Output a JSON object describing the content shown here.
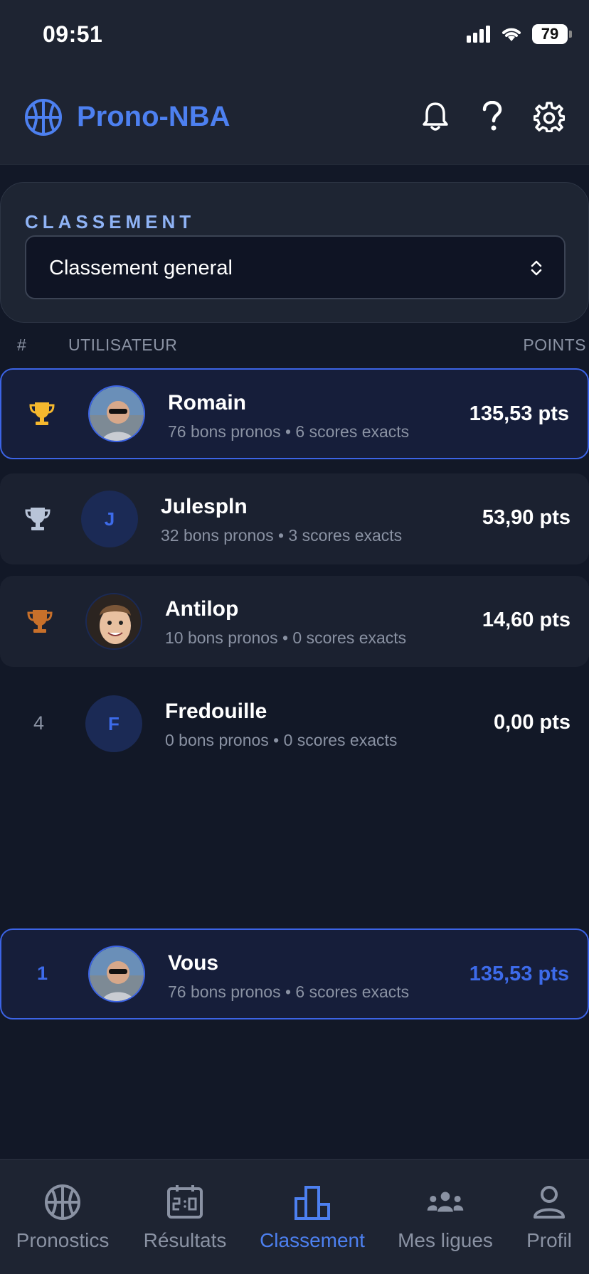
{
  "status": {
    "time": "09:51",
    "battery": "79"
  },
  "header": {
    "title": "Prono-NBA",
    "icons": [
      "basketball-icon",
      "bell-icon",
      "help-icon",
      "gear-icon"
    ]
  },
  "filter": {
    "label": "CLASSEMENT",
    "selected": "Classement general"
  },
  "columns": {
    "rank": "#",
    "user": "UTILISATEUR",
    "points": "POINTS"
  },
  "rows": [
    {
      "rank": "1",
      "rank_icon": "trophy-gold-icon",
      "name": "Romain",
      "stats": "76 bons pronos • 6 scores exacts",
      "points": "135,53 pts",
      "avatar": "photo"
    },
    {
      "rank": "2",
      "rank_icon": "trophy-silver-icon",
      "name": "Julespln",
      "stats": "32 bons pronos • 3 scores exacts",
      "points": "53,90 pts",
      "avatar": "J"
    },
    {
      "rank": "3",
      "rank_icon": "trophy-bronze-icon",
      "name": "Antilop",
      "stats": "10 bons pronos • 0 scores exacts",
      "points": "14,60 pts",
      "avatar": "photo"
    },
    {
      "rank": "4",
      "name": "Fredouille",
      "stats": "0 bons pronos • 0 scores exacts",
      "points": "0,00 pts",
      "avatar": "F"
    }
  ],
  "me": {
    "rank": "1",
    "name": "Vous",
    "stats": "76 bons pronos • 6 scores exacts",
    "points": "135,53 pts"
  },
  "nav": [
    {
      "label": "Pronostics",
      "icon": "basketball-icon"
    },
    {
      "label": "Résultats",
      "icon": "scoreboard-icon"
    },
    {
      "label": "Classement",
      "icon": "podium-icon",
      "active": true
    },
    {
      "label": "Mes ligues",
      "icon": "group-icon"
    },
    {
      "label": "Profil",
      "icon": "user-icon"
    }
  ],
  "colors": {
    "accent": "#3d6bea",
    "gold": "#f5b82e",
    "silver": "#b8c4d8",
    "bronze": "#c8702a"
  }
}
